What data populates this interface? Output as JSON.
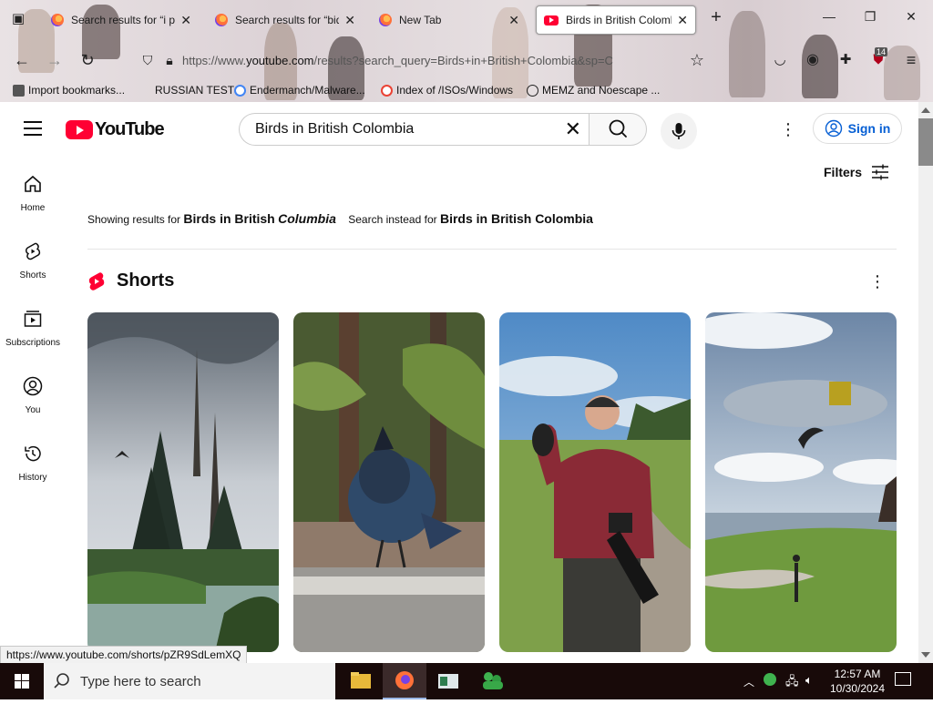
{
  "browser": {
    "tabs": [
      {
        "title": "Search results for “i ple",
        "icon": "firefox-icon"
      },
      {
        "title": "Search results for “bide",
        "icon": "firefox-icon"
      },
      {
        "title": "New Tab",
        "icon": "firefox-icon"
      },
      {
        "title": "Birds in British Colomb",
        "icon": "youtube-icon"
      }
    ],
    "url_prefix": "https://www.",
    "url_domain": "youtube.com",
    "url_rest": "/results?search_query=Birds+in+British+Colombia&sp=C",
    "extension_badge": "14",
    "bookmarks": [
      "Import bookmarks...",
      "RUSSIAN TEST",
      "Endermanch/Malware...",
      "Index of /ISOs/Windows",
      "MEMZ and Noescape ..."
    ]
  },
  "youtube": {
    "logo_text": "YouTube",
    "search_value": "Birds in British Colombia",
    "sign_in_label": "Sign in",
    "sidenav": [
      "Home",
      "Shorts",
      "Subscriptions",
      "You",
      "History"
    ],
    "filters_label": "Filters",
    "showing_prefix": "Showing results for",
    "showing_query_plain": "Birds in British",
    "showing_query_italic": "Columbia",
    "instead_prefix": "Search instead for",
    "instead_query": "Birds in British Colombia",
    "shorts_title": "Shorts",
    "brand_red": "#ff0033",
    "link_blue": "#065fd4"
  },
  "status_url": "https://www.youtube.com/shorts/pZR9SdLemXQ",
  "taskbar": {
    "search_placeholder": "Type here to search",
    "time": "12:57 AM",
    "date": "10/30/2024"
  }
}
